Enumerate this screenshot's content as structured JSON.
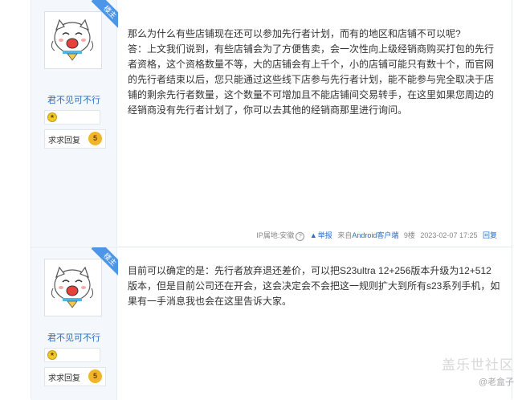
{
  "posts": [
    {
      "badge": "楼主",
      "username": "君不见可不行",
      "beg_label": "求求回复",
      "beg_count": "5",
      "paragraphs": [
        "那么为什么有些店铺现在还可以参加先行者计划，而有的地区和店铺不可以呢?",
        "答：上文我们说到，有些店铺会为了方便售卖，会一次性向上级经销商购买打包的先行者资格，这个资格数量不等，大的店铺会有上千个，小的店铺可能只有数十个，而官网的先行者结束以后，您只能通过这些线下店参与先行者计划，能不能参与完全取决于店铺的剩余先行者数量，这个数量不可增加且不能店铺间交易转手，在这里如果您周边的经销商没有先行者计划了，你可以去其他的经销商那里进行询问。"
      ],
      "footer": {
        "ip": "IP属地:安徽",
        "report": "举报",
        "client_prefix": "来自",
        "client": "Android客户端",
        "floor": "9楼",
        "time": "2023-02-07 17:25",
        "reply": "回复"
      }
    },
    {
      "badge": "楼主",
      "username": "君不见可不行",
      "beg_label": "求求回复",
      "beg_count": "5",
      "paragraphs": [
        "目前可以确定的是：先行者放弃退还差价，可以把S23ultra 12+256版本升级为12+512版本，但是目前公司还在开会，这会决定会不会把这一规则扩大到所有s23系列手机，如果有一手消息我也会在这里告诉大家。"
      ]
    }
  ],
  "watermark": {
    "title": "盖乐世社区",
    "author": "@老盒子"
  },
  "colors": {
    "accent": "#2b6dc2",
    "badge": "#4d95e6",
    "sidebar": "#f4f7fb"
  }
}
